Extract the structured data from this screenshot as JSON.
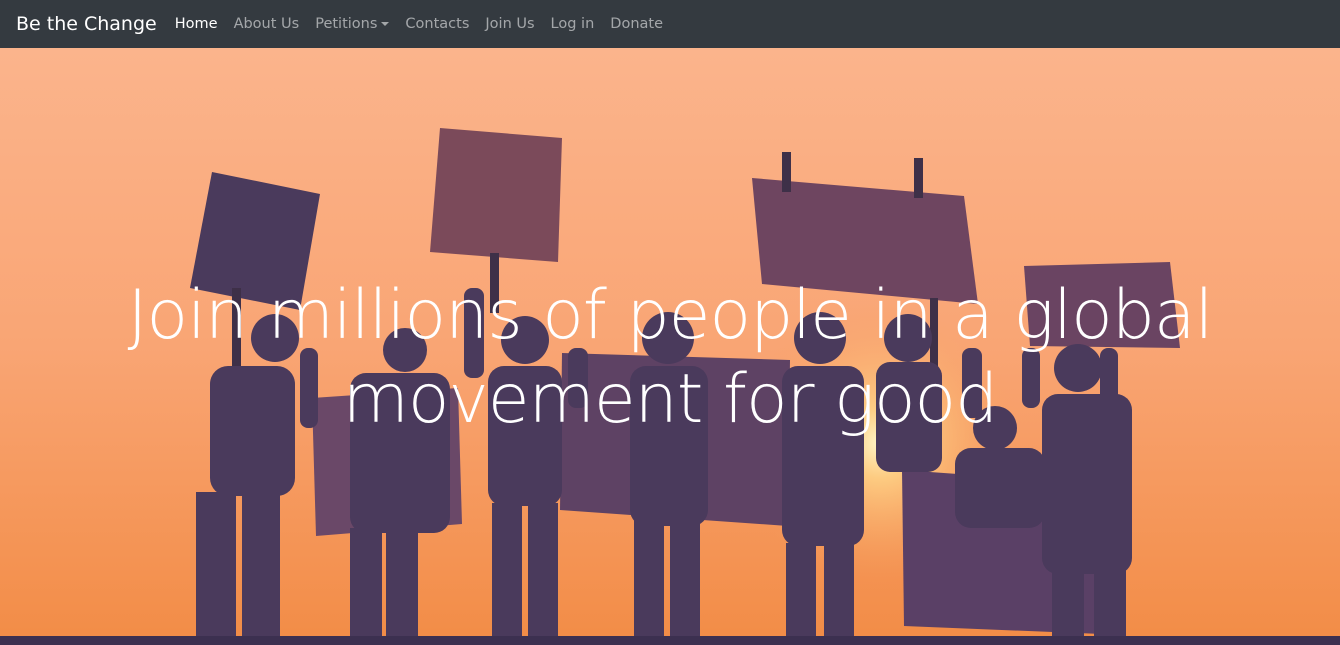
{
  "navbar": {
    "brand": "Be the Change",
    "links": [
      {
        "label": "Home",
        "active": true
      },
      {
        "label": "About Us",
        "active": false
      },
      {
        "label": "Petitions",
        "active": false,
        "dropdown": true
      },
      {
        "label": "Contacts",
        "active": false
      },
      {
        "label": "Join Us",
        "active": false
      },
      {
        "label": "Log in",
        "active": false
      },
      {
        "label": "Donate",
        "active": false
      }
    ]
  },
  "hero": {
    "title": "Join millions of people in a global movement for good",
    "image": "protesters-silhouette-sunset-photo"
  },
  "colors": {
    "navbar_bg": "#343a40",
    "brand_text": "#ffffff",
    "nav_link": "rgba(255,255,255,0.55)",
    "hero_sky": "#f8a272",
    "silhouette": "#4a3a5c"
  }
}
